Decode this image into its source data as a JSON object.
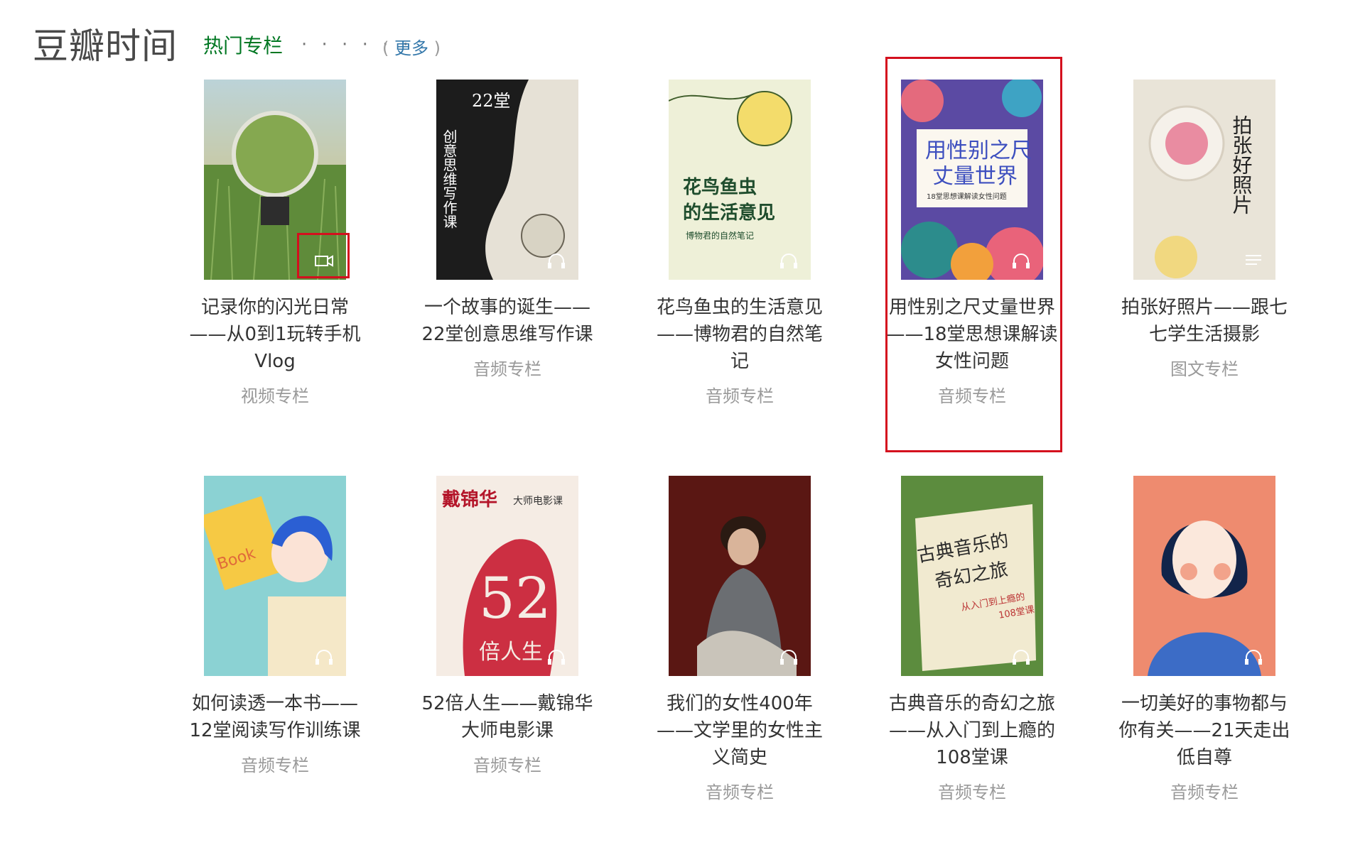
{
  "header": {
    "site_title": "豆瓣时间",
    "section_title": "热门专栏",
    "dots": "· · · · · ·",
    "more_open": "( ",
    "more_label": "更多",
    "more_close": " )"
  },
  "columns": [
    {
      "title": "记录你的闪光日常——从0到1玩转手机Vlog",
      "type": "视频专栏",
      "icon": "video-camera-icon"
    },
    {
      "title": "一个故事的诞生——22堂创意思维写作课",
      "type": "音频专栏",
      "icon": "headphones-icon"
    },
    {
      "title": "花鸟鱼虫的生活意见——博物君的自然笔记",
      "type": "音频专栏",
      "icon": "headphones-icon"
    },
    {
      "title": "用性别之尺丈量世界——18堂思想课解读女性问题",
      "type": "音频专栏",
      "icon": "headphones-icon"
    },
    {
      "title": "拍张好照片——跟七七学生活摄影",
      "type": "图文专栏",
      "icon": "text-lines-icon"
    },
    {
      "title": "如何读透一本书——12堂阅读写作训练课",
      "type": "音频专栏",
      "icon": "headphones-icon"
    },
    {
      "title": "52倍人生——戴锦华大师电影课",
      "type": "音频专栏",
      "icon": "headphones-icon"
    },
    {
      "title": "我们的女性400年——文学里的女性主义简史",
      "type": "音频专栏",
      "icon": "headphones-icon"
    },
    {
      "title": "古典音乐的奇幻之旅——从入门到上瘾的108堂课",
      "type": "音频专栏",
      "icon": "headphones-icon"
    },
    {
      "title": "一切美好的事物都与你有关——21天走出低自尊",
      "type": "音频专栏",
      "icon": "headphones-icon"
    }
  ],
  "covers": [
    {
      "lines": []
    },
    {
      "lines": [
        "22堂",
        "创意思维写作课"
      ]
    },
    {
      "lines": [
        "花鸟鱼虫",
        "的生活意见",
        "博物君的自然笔记"
      ]
    },
    {
      "lines": [
        "用性别之尺",
        "丈量世界",
        "18堂思想课解读女性问题"
      ]
    },
    {
      "lines": [
        "拍张好照片"
      ]
    },
    {
      "lines": [
        "Book"
      ]
    },
    {
      "lines": [
        "戴锦华",
        "大师电影课",
        "52",
        "倍人生"
      ]
    },
    {
      "lines": []
    },
    {
      "lines": [
        "古典音乐的",
        "奇幻之旅",
        "从入门到上瘾的",
        "108堂课"
      ]
    },
    {
      "lines": []
    }
  ],
  "colors": {
    "link": "#3377aa",
    "section_green": "#007722",
    "highlight_red": "#d4101e",
    "meta_gray": "#999999"
  }
}
